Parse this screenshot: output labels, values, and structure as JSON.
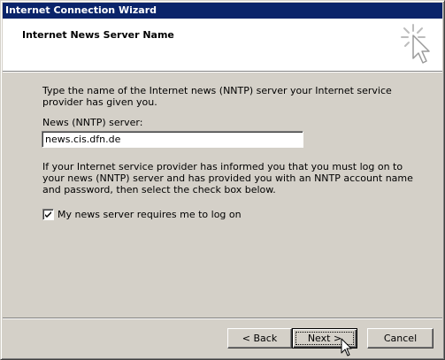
{
  "window": {
    "title": "Internet Connection Wizard"
  },
  "header": {
    "title": "Internet News Server Name",
    "icon": "wizard-click-cursor-icon"
  },
  "main": {
    "intro": "Type the name of the Internet news (NNTP) server your Internet service provider has given you.",
    "server_label": "News (NNTP) server:",
    "server_value": "news.cis.dfn.de",
    "logon_info": "If your Internet service provider has informed you that you must log on to your news (NNTP) server and has provided you with an NNTP account name and password, then select the check box below.",
    "logon_checkbox_label": "My news server requires me to log on",
    "logon_checkbox_checked": true
  },
  "buttons": {
    "back": "< Back",
    "next": "Next >",
    "cancel": "Cancel"
  },
  "colors": {
    "titlebar": "#0a246a",
    "face": "#d4d0c8",
    "header_bg": "#ffffff"
  }
}
